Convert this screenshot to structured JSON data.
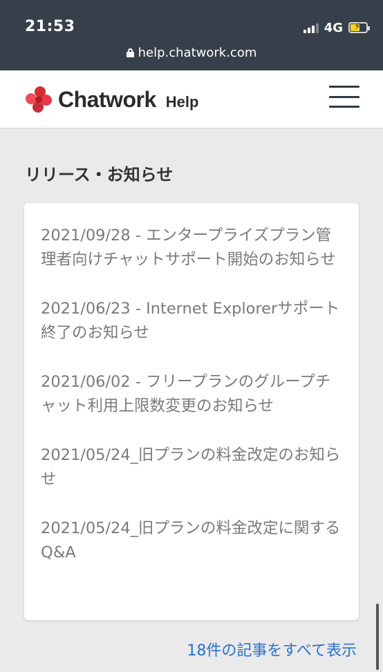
{
  "status_bar": {
    "time": "21:53",
    "network": "4G",
    "url": "help.chatwork.com"
  },
  "header": {
    "brand": "Chatwork",
    "brand_suffix": "Help",
    "logo_colors": [
      "#e2383f",
      "#ef5350",
      "#c62828",
      "#e53935"
    ],
    "menu_icon": "hamburger-menu-icon"
  },
  "section": {
    "title": "リリース・お知らせ",
    "articles": [
      {
        "title": "2021/09/28 - エンタープライズプラン管理者向けチャットサポート開始のお知らせ"
      },
      {
        "title": "2021/06/23 - Internet Explorerサポート終了のお知らせ"
      },
      {
        "title": "2021/06/02 - フリープランのグループチャット利用上限数変更のお知らせ"
      },
      {
        "title": "2021/05/24_旧プランの料金改定のお知らせ"
      },
      {
        "title": "2021/05/24_旧プランの料金改定に関するQ&A"
      }
    ],
    "view_all_label": "18件の記事をすべて表示"
  },
  "colors": {
    "status_bg": "#37404a",
    "link": "#2a71c9",
    "article_text": "#7a7a7a",
    "page_bg": "#eaeaea"
  }
}
